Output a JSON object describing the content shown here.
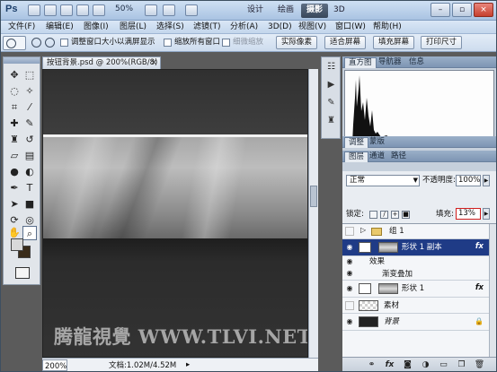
{
  "titlebar": {
    "logo": "Ps",
    "zoom": "50%",
    "workspaces": [
      "设计",
      "绘画",
      "摄影"
    ],
    "active_workspace": "摄影",
    "more": "3D",
    "win_min": "–",
    "win_max": "▫",
    "win_close": "×"
  },
  "menu": [
    "文件(F)",
    "编辑(E)",
    "图像(I)",
    "图层(L)",
    "选择(S)",
    "滤镜(T)",
    "分析(A)",
    "3D(D)",
    "视图(V)",
    "窗口(W)",
    "帮助(H)"
  ],
  "options": {
    "resize_windows": "调整窗口大小以满屏显示",
    "zoom_all": "缩放所有窗口",
    "scrubby": "细微缩放",
    "actual_pixels": "实际像素",
    "fit_screen": "适合屏幕",
    "fill_screen": "填充屏幕",
    "print_size": "打印尺寸"
  },
  "document": {
    "tab": "按钮背景.psd @ 200%(RGB/8) *",
    "close": "×",
    "watermark": "腾龍視覺 WWW.TLVI.NET",
    "zoom": "200%",
    "info": "文档:1.02M/4.52M"
  },
  "panels": {
    "top_tabs": [
      "直方图",
      "导航器",
      "信息"
    ],
    "mid_tabs": [
      "调整",
      "蒙版"
    ],
    "layers_tabs": [
      "图层",
      "通道",
      "路径"
    ],
    "blend_mode": "正常",
    "opacity_label": "不透明度:",
    "opacity": "100%",
    "lock_label": "锁定:",
    "fill_label": "填充:",
    "fill": "13%",
    "layers": [
      {
        "name": "组 1",
        "kind": "group",
        "visible": false,
        "selected": false
      },
      {
        "name": "形状 1 副本",
        "kind": "shape",
        "visible": true,
        "selected": true,
        "fx": "fx"
      },
      {
        "name": "效果",
        "kind": "effects",
        "visible": true,
        "selected": false
      },
      {
        "name": "渐变叠加",
        "kind": "effect",
        "visible": true,
        "selected": false
      },
      {
        "name": "形状 1",
        "kind": "shape",
        "visible": true,
        "selected": false,
        "fx": "fx"
      },
      {
        "name": "素材",
        "kind": "pixel",
        "visible": false,
        "selected": false
      },
      {
        "name": "背景",
        "kind": "background",
        "visible": true,
        "selected": false,
        "locked": true
      }
    ],
    "footer_icons": [
      "link-icon",
      "fx-icon",
      "mask-icon",
      "adjustment-icon",
      "folder-icon",
      "new-layer-icon",
      "trash-icon"
    ]
  },
  "colors": {
    "selected_layer": "#1f3b86",
    "fill_highlight": "#d11e1e",
    "foreground": "#d9d9d9",
    "background": "#3a2c1a"
  }
}
